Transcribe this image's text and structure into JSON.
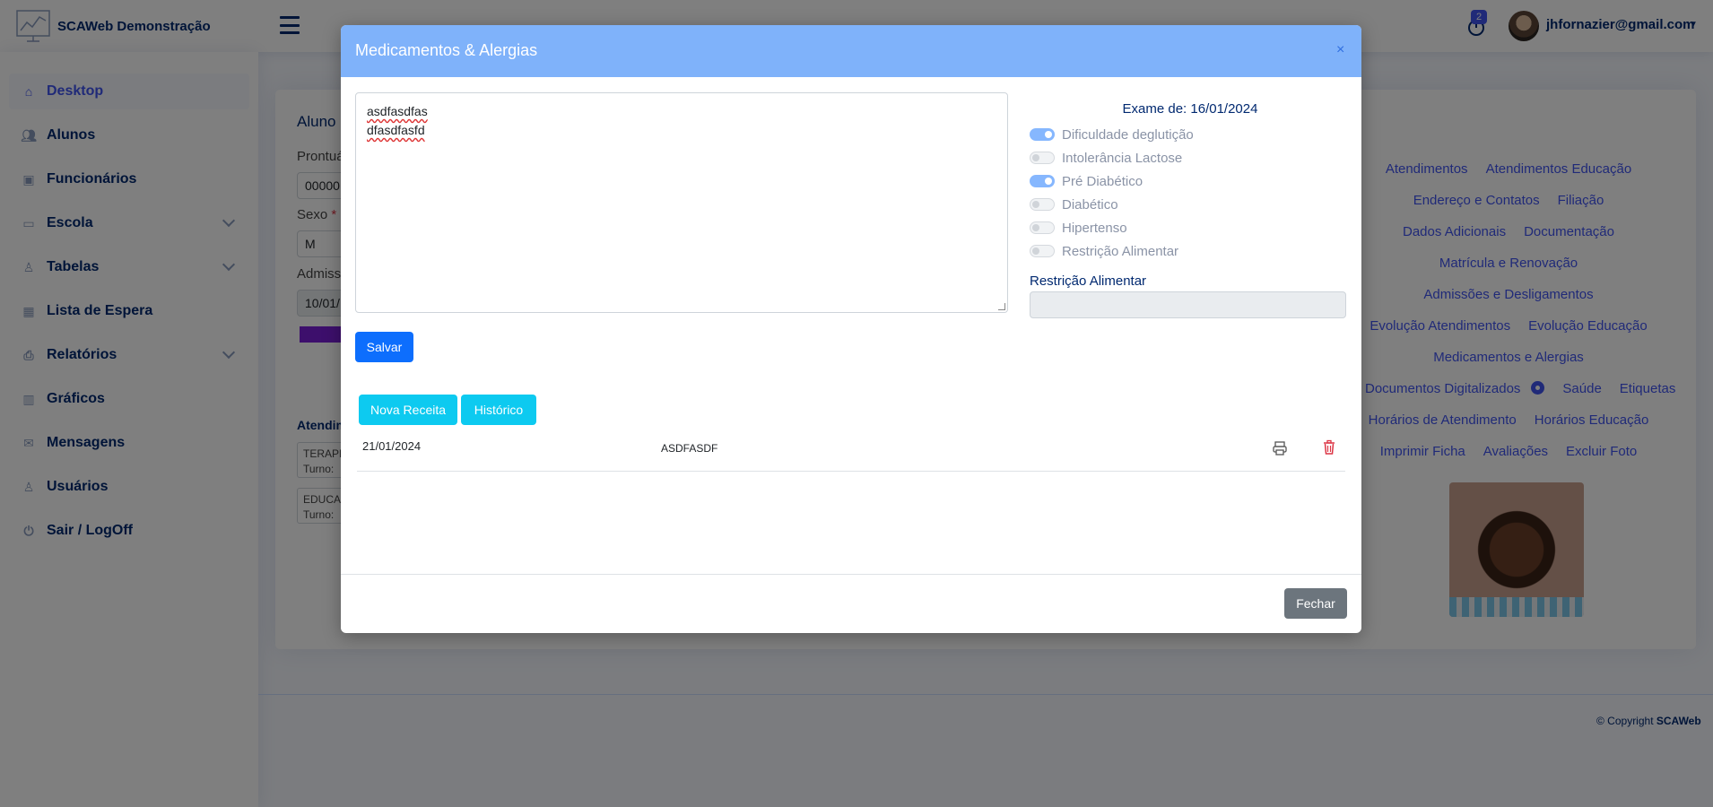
{
  "app": {
    "title": "SCAWeb Demonstração"
  },
  "header": {
    "notification_count": "2",
    "user_email": "jhfornazier@gmail.com"
  },
  "sidebar": {
    "items": [
      {
        "label": "Desktop",
        "icon": "home-icon"
      },
      {
        "label": "Alunos",
        "icon": "people-icon"
      },
      {
        "label": "Funcionários",
        "icon": "person-badge-icon"
      },
      {
        "label": "Escola",
        "icon": "briefcase-icon"
      },
      {
        "label": "Tabelas",
        "icon": "person-tables-icon"
      },
      {
        "label": "Lista de Espera",
        "icon": "calendar-icon"
      },
      {
        "label": "Relatórios",
        "icon": "printer-icon"
      },
      {
        "label": "Gráficos",
        "icon": "bar-chart-icon"
      },
      {
        "label": "Mensagens",
        "icon": "envelope-icon"
      },
      {
        "label": "Usuários",
        "icon": "person-icon"
      },
      {
        "label": "Sair / LogOff",
        "icon": "power-icon"
      }
    ]
  },
  "background": {
    "card_title": "Aluno",
    "prontuario_label": "Prontuá",
    "prontuario_value": "00000",
    "sexo_label": "Sexo",
    "sexo_value": "M",
    "admissao_label": "Admissã",
    "admissao_value": "10/01/",
    "atendimentos_label": "Atendim",
    "box1_line1": "TERAPE",
    "box1_line2": "Turno:",
    "box2_line1": "EDUCA",
    "box2_line2": "Turno:",
    "links": {
      "atendimentos": "Atendimentos",
      "atendimentos_educacao": "Atendimentos Educação",
      "endereco": "Endereço e Contatos",
      "filiacao": "Filiação",
      "dados_adicionais": "Dados Adicionais",
      "documentacao": "Documentação",
      "matricula": "Matrícula e Renovação",
      "admissoes": "Admissões e Desligamentos",
      "evolucao_atendimentos": "Evolução Atendimentos",
      "evolucao_educacao": "Evolução Educação",
      "medicamentos": "Medicamentos e Alergias",
      "documentos": "Documentos Digitalizados",
      "saude": "Saúde",
      "etiquetas": "Etiquetas",
      "horarios_atendimento": "Horários de Atendimento",
      "horarios_educacao": "Horários Educação",
      "imprimir_ficha": "Imprimir Ficha",
      "avaliacoes": "Avaliações",
      "excluir_foto": "Excluir Foto"
    },
    "copyright_prefix": "© Copyright",
    "copyright_brand": "SCAWeb"
  },
  "modal": {
    "title": "Medicamentos & Alergias",
    "close": "×",
    "notes_line1": "asdfasdfas",
    "notes_line2": "dfasdfasfd",
    "save_label": "Salvar",
    "exam_label": "Exame de: 16/01/2024",
    "toggles": [
      {
        "label": "Dificuldade deglutição",
        "on": true
      },
      {
        "label": "Intolerância Lactose",
        "on": false
      },
      {
        "label": "Pré Diabético",
        "on": true
      },
      {
        "label": "Diabético",
        "on": false
      },
      {
        "label": "Hipertenso",
        "on": false
      },
      {
        "label": "Restrição Alimentar",
        "on": false
      }
    ],
    "restriction_label": "Restrição Alimentar",
    "restriction_value": "",
    "new_prescription_label": "Nova Receita",
    "history_label": "Histórico",
    "prescriptions": [
      {
        "date": "21/01/2024",
        "name": "ASDFASDF"
      }
    ],
    "close_button_label": "Fechar"
  },
  "colors": {
    "accent": "#4154f1",
    "modal_header": "#7fb2fa",
    "primary": "#0d6efd",
    "info": "#0dcaf0",
    "secondary": "#6c757d",
    "danger": "#dc3545"
  }
}
